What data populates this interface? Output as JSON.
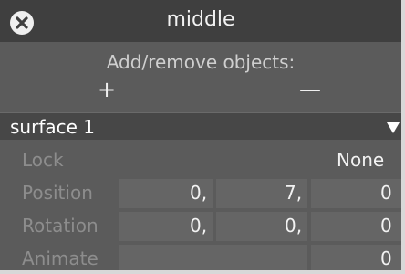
{
  "window": {
    "title": "middle"
  },
  "objects": {
    "heading": "Add/remove objects:",
    "add_symbol": "+",
    "remove_symbol": "—"
  },
  "surface": {
    "label": "surface 1",
    "lock": {
      "label": "Lock",
      "value": "None"
    },
    "position": {
      "label": "Position",
      "x": "0,",
      "y": "7,",
      "z": "0"
    },
    "rotation": {
      "label": "Rotation",
      "x": "0,",
      "y": "0,",
      "z": "0"
    },
    "animate": {
      "label": "Animate",
      "value": "0"
    }
  }
}
